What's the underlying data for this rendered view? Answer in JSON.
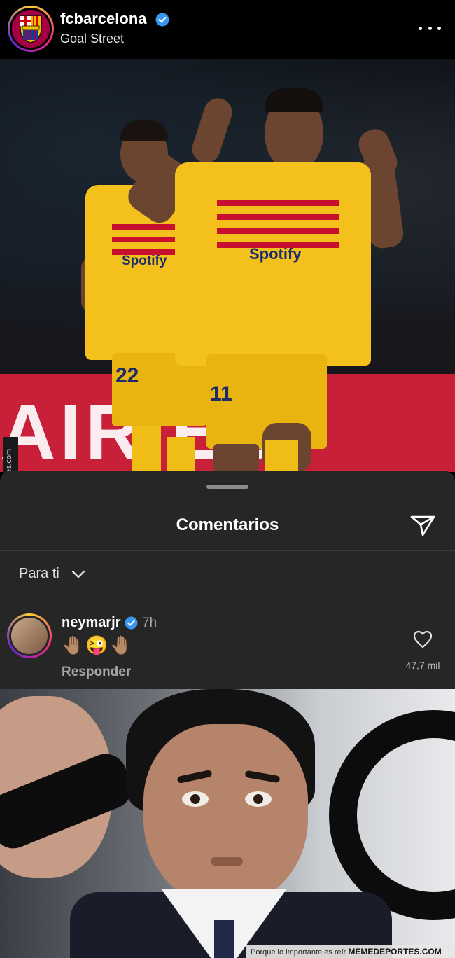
{
  "header": {
    "username": "fcbarcelona",
    "subtitle": "Goal Street",
    "verified_icon": "verified-badge-icon",
    "more_icon": "more-options-icon",
    "accent": "#a50044"
  },
  "photo": {
    "board_text": "AIR ES",
    "player_front": {
      "sponsor": "Spotify",
      "number": "11"
    },
    "player_back": {
      "sponsor": "Spotify",
      "number": "22"
    },
    "jersey_color": "#f4c01c",
    "stripe_color": "#c8102e"
  },
  "watermark_side": "Memedeportes.com",
  "comments": {
    "title": "Comentarios",
    "send_icon": "send-icon",
    "filter_label": "Para ti",
    "items": [
      {
        "user": "neymarjr",
        "time": "7h",
        "text": "🤚🏽😜🤚🏽",
        "reply_label": "Responder",
        "likes": "47,7 mil"
      }
    ]
  },
  "footer_watermark": {
    "tagline": "Porque lo importante es reír",
    "brand": "MEMEDEPORTES.COM"
  }
}
